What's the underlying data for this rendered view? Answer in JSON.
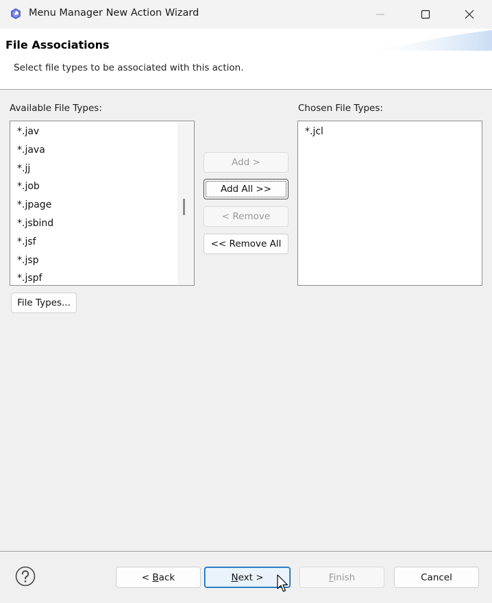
{
  "window": {
    "title": "Menu Manager New Action Wizard",
    "accent": "#0a64c8"
  },
  "header": {
    "title": "File Associations",
    "description": "Select file types to be associated with this action."
  },
  "available": {
    "label": "Available File Types:",
    "items": [
      "*.jav",
      "*.java",
      "*.jj",
      "*.job",
      "*.jpage",
      "*.jsbind",
      "*.jsf",
      "*.jsp",
      "*.jspf"
    ]
  },
  "chosen": {
    "label": "Chosen File Types:",
    "items": [
      "*.jcl"
    ]
  },
  "buttons": {
    "add": "Add >",
    "add_all": "Add All >>",
    "remove": "< Remove",
    "remove_all": "<< Remove All",
    "file_types": "File Types..."
  },
  "footer": {
    "back_pre": "< ",
    "back_mnemonic": "B",
    "back_post": "ack",
    "next_mnemonic": "N",
    "next_post": "ext >",
    "finish_mnemonic": "F",
    "finish_post": "inish",
    "cancel": "Cancel"
  },
  "icons": {
    "app": "eclipse-app-icon",
    "minimize": "minimize-icon",
    "maximize": "maximize-icon",
    "close": "close-icon",
    "help": "help-icon",
    "cursor": "mouse-cursor-icon"
  }
}
